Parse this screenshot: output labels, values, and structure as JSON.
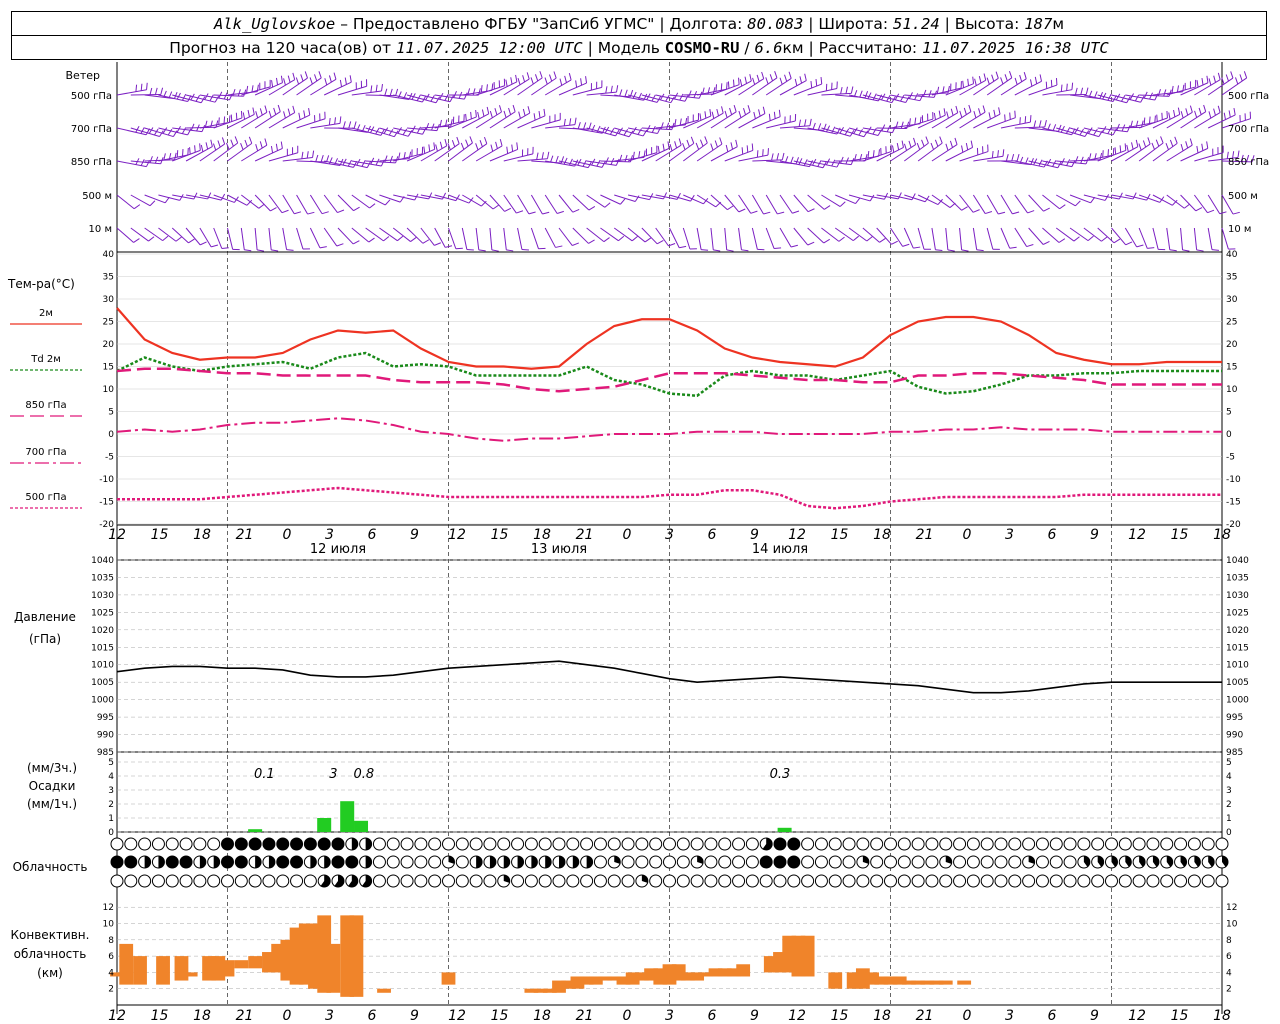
{
  "header": {
    "station": "Alk_Uglovskoe",
    "provider_prefix": " – Предоставлено ФГБУ \"ЗапСиб УГМС\" | Долгота: ",
    "longitude": "80.083",
    "lat_prefix": " | Широта: ",
    "latitude": "51.24",
    "alt_prefix": " | Высота: ",
    "altitude": "187",
    "alt_unit": "м",
    "forecast_prefix": "Прогноз на 120 часа(ов) от ",
    "forecast_start": "11.07.2025 12:00 UTC",
    "model_prefix": " | Модель ",
    "model": "COSMO-RU",
    "model_sep": " / ",
    "resolution": "6.6",
    "res_unit": "км",
    "calc_prefix": " | Рассчитано: ",
    "calculated": "11.07.2025 16:38 UTC"
  },
  "colors": {
    "wind": "#7b1fc2",
    "t2m": "#ee3322",
    "td2m": "#1a8a1a",
    "t850": "#e0197a",
    "t700": "#e0197a",
    "t500": "#e0197a",
    "pressure": "#000000",
    "precip": "#22cc22",
    "convective": "#f0842a"
  },
  "wind_panel": {
    "title": "Ветер",
    "levels": [
      "500 гПа",
      "700 гПа",
      "850 гПа",
      "500 м",
      "10  м"
    ]
  },
  "temp_panel": {
    "title": "Тем-ра(°C)",
    "legend": [
      "2м",
      "Td  2м",
      "850 гПа",
      "700 гПа",
      "500 гПа"
    ]
  },
  "pressure_panel": {
    "title": "Давление",
    "unit": "(гПа)"
  },
  "precip_panel": {
    "unit3h": "(мм/3ч.)",
    "title": "Осадки",
    "unit1h": "(мм/1ч.)",
    "totals": [
      "0.1",
      "3",
      "0.8",
      "0.3"
    ]
  },
  "cloud_panel": {
    "title": "Облачность"
  },
  "conv_panel": {
    "title_lines": [
      "Конвективн.",
      "облачность",
      "(км)"
    ]
  },
  "time_axis": {
    "hour_labels": [
      "12",
      "15",
      "18",
      "21",
      "0",
      "3",
      "6",
      "9",
      "12",
      "15",
      "18",
      "21",
      "0",
      "3",
      "6",
      "9",
      "12",
      "15",
      "18",
      "21",
      "0",
      "3",
      "6",
      "9",
      "12",
      "15",
      "18"
    ],
    "date_labels": [
      "12 июля",
      "13 июля",
      "14 июля"
    ]
  },
  "chart_data": [
    {
      "type": "line",
      "panel": "temperature",
      "x_hours": [
        0,
        3,
        6,
        9,
        12,
        15,
        18,
        21,
        24,
        27,
        30,
        33,
        36,
        39,
        42,
        45,
        48,
        51,
        54,
        57,
        60,
        63,
        66,
        69,
        72,
        75,
        78,
        81,
        84,
        87,
        90,
        93,
        96,
        99,
        102,
        105,
        108,
        111,
        114,
        117,
        120
      ],
      "ylim": [
        -20,
        40
      ],
      "yticks": [
        -20,
        -15,
        -10,
        -5,
        0,
        5,
        10,
        15,
        20,
        25,
        30,
        35,
        40
      ],
      "series": [
        {
          "name": "2м",
          "values": [
            28,
            21,
            18,
            16.5,
            17,
            17,
            18,
            21,
            23,
            22.5,
            23,
            19,
            16,
            15,
            15,
            14.5,
            15,
            20,
            24,
            25.5,
            25.5,
            23,
            19,
            17,
            16,
            15.5,
            15,
            17,
            22,
            25,
            26,
            26,
            25,
            22,
            18,
            16.5,
            15.5,
            15.5,
            16,
            16,
            16
          ]
        },
        {
          "name": "Td  2м",
          "values": [
            14,
            17,
            15,
            14,
            15,
            15.5,
            16,
            14.5,
            17,
            18,
            15,
            15.5,
            15,
            13,
            13,
            13,
            13,
            15,
            12,
            11,
            9,
            8.5,
            13,
            14,
            13,
            13,
            12,
            13,
            14,
            10.5,
            9,
            9.5,
            11,
            13,
            13,
            13.5,
            13.5,
            14,
            14,
            14,
            14
          ]
        },
        {
          "name": "850 гПа",
          "values": [
            14,
            14.5,
            14.5,
            14,
            13.5,
            13.5,
            13,
            13,
            13,
            13,
            12,
            11.5,
            11.5,
            11.5,
            11,
            10,
            9.5,
            10,
            10.5,
            12,
            13.5,
            13.5,
            13.5,
            13,
            12.5,
            12,
            12,
            11.5,
            11.5,
            13,
            13,
            13.5,
            13.5,
            13,
            12.5,
            12,
            11,
            11,
            11,
            11,
            11
          ]
        },
        {
          "name": "700 гПа",
          "values": [
            0.5,
            1,
            0.5,
            1,
            2,
            2.5,
            2.5,
            3,
            3.5,
            3,
            2,
            0.5,
            0,
            -1,
            -1.5,
            -1,
            -1,
            -0.5,
            0,
            0,
            0,
            0.5,
            0.5,
            0.5,
            0,
            0,
            0,
            0,
            0.5,
            0.5,
            1,
            1,
            1.5,
            1,
            1,
            1,
            0.5,
            0.5,
            0.5,
            0.5,
            0.5
          ]
        },
        {
          "name": "500 гПа",
          "values": [
            -14.5,
            -14.5,
            -14.5,
            -14.5,
            -14,
            -13.5,
            -13,
            -12.5,
            -12,
            -12.5,
            -13,
            -13.5,
            -14,
            -14,
            -14,
            -14,
            -14,
            -14,
            -14,
            -14,
            -13.5,
            -13.5,
            -12.5,
            -12.5,
            -13.5,
            -16,
            -16.5,
            -16,
            -15,
            -14.5,
            -14,
            -14,
            -14,
            -14,
            -14,
            -13.5,
            -13.5,
            -13.5,
            -13.5,
            -13.5,
            -13.5
          ]
        }
      ]
    },
    {
      "type": "line",
      "panel": "pressure",
      "x_hours": [
        0,
        3,
        6,
        9,
        12,
        15,
        18,
        21,
        24,
        27,
        30,
        33,
        36,
        39,
        42,
        45,
        48,
        51,
        54,
        57,
        60,
        63,
        66,
        69,
        72,
        75,
        78,
        81,
        84,
        87,
        90,
        93,
        96,
        99,
        102,
        105,
        108,
        111,
        114,
        117,
        120
      ],
      "ylim": [
        985,
        1040
      ],
      "yticks": [
        985,
        990,
        995,
        1000,
        1005,
        1010,
        1015,
        1020,
        1025,
        1030,
        1035,
        1040
      ],
      "series": [
        {
          "name": "Давление",
          "values": [
            1008,
            1009,
            1009.5,
            1009.5,
            1009,
            1009,
            1008.5,
            1007,
            1006.5,
            1006.5,
            1007,
            1008,
            1009,
            1009.5,
            1010,
            1010.5,
            1011,
            1010,
            1009,
            1007.5,
            1006,
            1005,
            1005.5,
            1006,
            1006.5,
            1006,
            1005.5,
            1005,
            1004.5,
            1004,
            1003,
            1002,
            1002,
            1002.5,
            1003.5,
            1004.5,
            1005,
            1005,
            1005,
            1005,
            1005
          ]
        }
      ]
    },
    {
      "type": "bar",
      "panel": "precipitation",
      "ylim": [
        0,
        5
      ],
      "yticks": [
        0,
        1,
        2,
        3,
        4,
        5
      ],
      "series": [
        {
          "name": "Осадки",
          "x_hours": [
            15,
            22.5,
            25,
            26.5,
            72.5
          ],
          "values": [
            0.2,
            1,
            2.2,
            0.8,
            0.3
          ]
        }
      ]
    },
    {
      "type": "bar",
      "panel": "convective_cloud",
      "ylim": [
        0,
        12
      ],
      "yticks": [
        2,
        4,
        6,
        8,
        10,
        12
      ],
      "series": [
        {
          "name": "Конвективная облачность",
          "x_hours": [
            0,
            1,
            2.5,
            5,
            7,
            8,
            10,
            11,
            12,
            13.5,
            15,
            16.5,
            17.5,
            18.5,
            19.5,
            20.5,
            21.5,
            22.5,
            23.5,
            25,
            26,
            29,
            36,
            45,
            46,
            47,
            48,
            49,
            50,
            51,
            52,
            53,
            54,
            55,
            56,
            57,
            58,
            59,
            60,
            61,
            62,
            63,
            64,
            65,
            66,
            67,
            68,
            71,
            72,
            73,
            74,
            75,
            78,
            80,
            81,
            82,
            83,
            84,
            85,
            86,
            87,
            88,
            89,
            90,
            92
          ],
          "bottoms": [
            3.5,
            2.5,
            2.5,
            2.5,
            3,
            3.5,
            3,
            3,
            3.5,
            4.5,
            4.5,
            4,
            4,
            3,
            2.5,
            2.5,
            2,
            1.5,
            1.5,
            1,
            1,
            1.5,
            2.5,
            1.5,
            1.5,
            1.5,
            1.5,
            2,
            2,
            2.5,
            2.5,
            3,
            3,
            2.5,
            2.5,
            3,
            3,
            2.5,
            2.5,
            3,
            3,
            3,
            3.5,
            3.5,
            3.5,
            3.5,
            3.5,
            4,
            4,
            4,
            3.5,
            3.5,
            2,
            2,
            2,
            2.5,
            2.5,
            2.5,
            2.5,
            2.5,
            2.5,
            2.5,
            2.5,
            2.5,
            2.5
          ],
          "tops": [
            4,
            7.5,
            6,
            6,
            6,
            4,
            6,
            6,
            5.5,
            5.5,
            6,
            6.5,
            7.5,
            8,
            9.5,
            10,
            10,
            11,
            7.5,
            11,
            11,
            2,
            4,
            2,
            2,
            2,
            3,
            3,
            3.5,
            3.5,
            3.5,
            3.5,
            3.5,
            3.5,
            4,
            4,
            4.5,
            4.5,
            5,
            5,
            4,
            4,
            4,
            4.5,
            4.5,
            4.5,
            5,
            6,
            6.5,
            8.5,
            8.5,
            8.5,
            4,
            4,
            4.5,
            4,
            3.5,
            3.5,
            3.5,
            3,
            3,
            3,
            3,
            3,
            3
          ]
        }
      ]
    }
  ]
}
